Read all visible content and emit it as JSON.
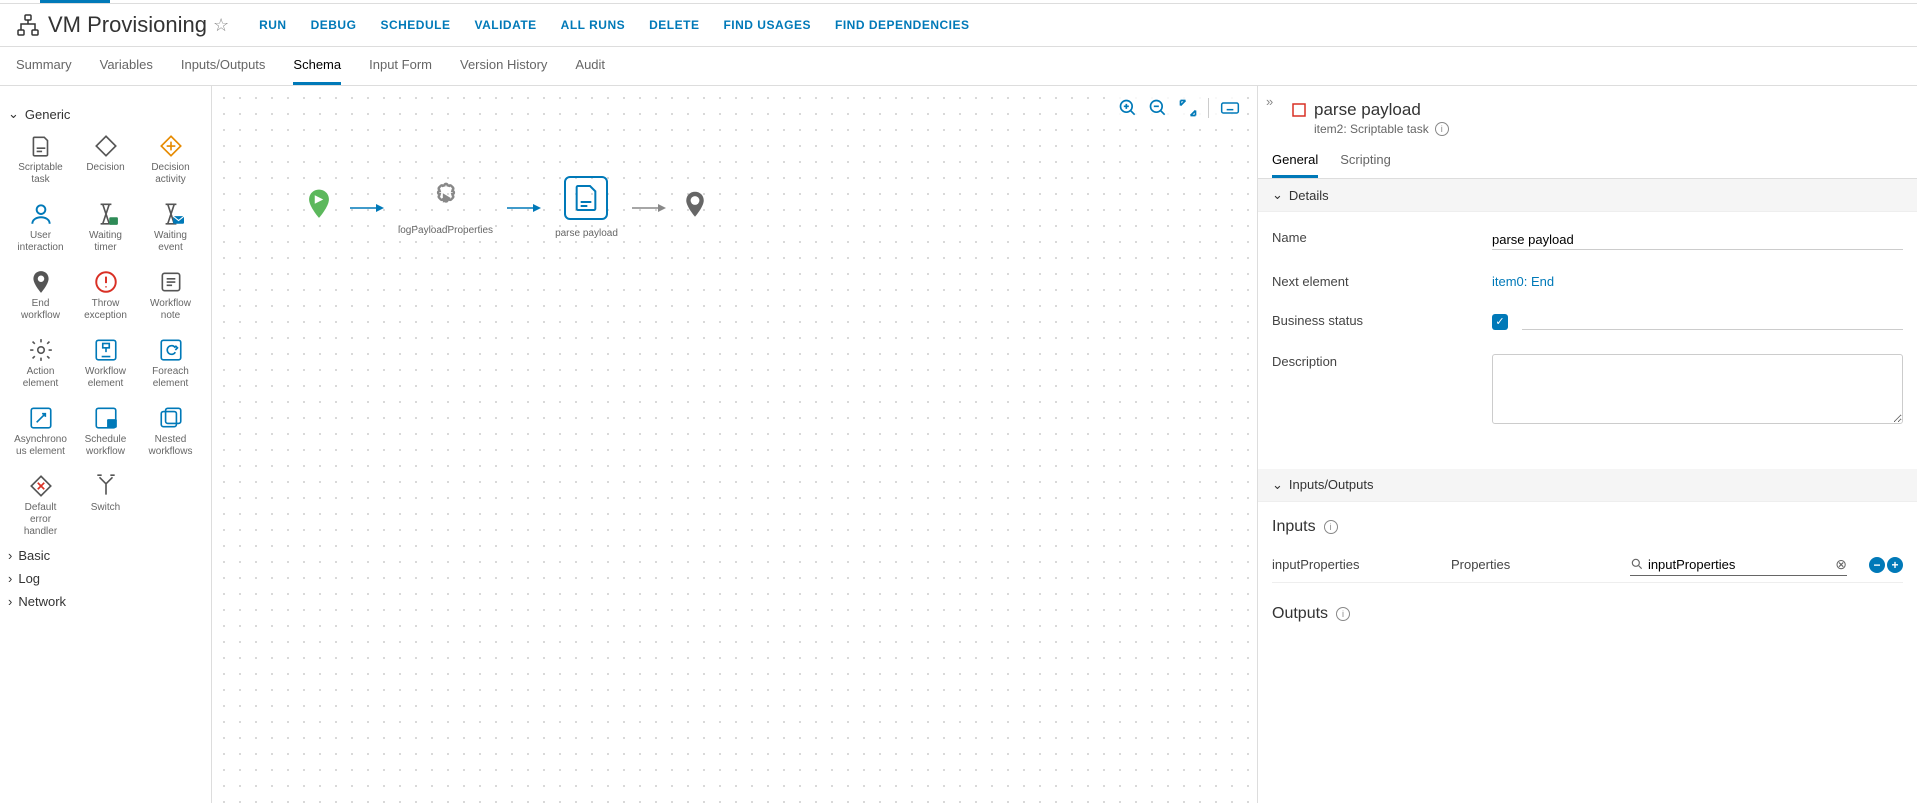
{
  "header": {
    "title": "VM Provisioning",
    "actions": [
      "RUN",
      "DEBUG",
      "SCHEDULE",
      "VALIDATE",
      "ALL RUNS",
      "DELETE",
      "FIND USAGES",
      "FIND DEPENDENCIES"
    ]
  },
  "tabs": [
    "Summary",
    "Variables",
    "Inputs/Outputs",
    "Schema",
    "Input Form",
    "Version History",
    "Audit"
  ],
  "active_tab": "Schema",
  "palette": {
    "groups": {
      "generic": {
        "label": "Generic",
        "items": [
          "Scriptable task",
          "Decision",
          "Decision activity",
          "User interaction",
          "Waiting timer",
          "Waiting event",
          "End workflow",
          "Throw exception",
          "Workflow note",
          "Action element",
          "Workflow element",
          "Foreach element",
          "Asynchronous element",
          "Schedule workflow",
          "Nested workflows",
          "Default error handler",
          "Switch"
        ]
      },
      "basic": {
        "label": "Basic"
      },
      "log": {
        "label": "Log"
      },
      "network": {
        "label": "Network"
      }
    }
  },
  "canvas": {
    "nodes": {
      "start": {
        "type": "start"
      },
      "n1": {
        "label": "logPayloadProperties",
        "type": "action"
      },
      "n2": {
        "label": "parse payload",
        "type": "script",
        "selected": true
      },
      "end": {
        "type": "end"
      }
    }
  },
  "props": {
    "title": "parse payload",
    "subtitle": "item2: Scriptable task",
    "tabs": [
      "General",
      "Scripting"
    ],
    "active_tab": "General",
    "sections": {
      "details": {
        "label": "Details",
        "name": "parse payload",
        "next_element": "item0: End",
        "business_status_checked": true,
        "description": "",
        "labels": {
          "name": "Name",
          "next_element": "Next element",
          "business_status": "Business status",
          "description": "Description"
        }
      },
      "io": {
        "label": "Inputs/Outputs",
        "inputs_title": "Inputs",
        "outputs_title": "Outputs",
        "inputs": [
          {
            "name": "inputProperties",
            "type": "Properties",
            "bind": "inputProperties"
          }
        ]
      }
    }
  }
}
